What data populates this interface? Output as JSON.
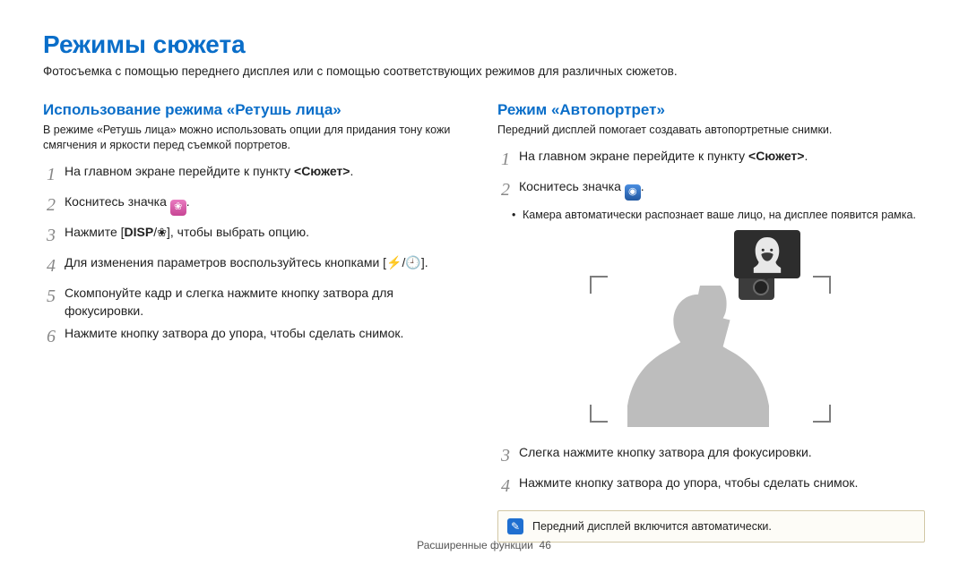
{
  "title": "Режимы сюжета",
  "intro": "Фотосъемка с помощью переднего дисплея или с помощью соответствующих режимов для различных сюжетов.",
  "left": {
    "heading": "Использование режима «Ретушь лица»",
    "desc": "В режиме «Ретушь лица» можно использовать опции для придания тону кожи смягчения и яркости перед съемкой портретов.",
    "steps": {
      "s1a": "На главном экране перейдите к пункту ",
      "s1b": "<Сюжет>",
      "s1c": ".",
      "s2a": "Коснитесь значка ",
      "s2b": ".",
      "s3a": "Нажмите [",
      "s3disp": "DISP",
      "s3slash": "/",
      "s3b": "], чтобы выбрать опцию.",
      "s4a": "Для изменения параметров воспользуйтесь кнопками [",
      "s4b": "/",
      "s4c": "].",
      "s5": "Скомпонуйте кадр и слегка нажмите кнопку затвора для фокусировки.",
      "s6": "Нажмите кнопку затвора до упора, чтобы сделать снимок."
    }
  },
  "right": {
    "heading": "Режим «Автопортрет»",
    "desc": "Передний дисплей помогает создавать автопортретные снимки.",
    "steps": {
      "s1a": "На главном экране перейдите к пункту ",
      "s1b": "<Сюжет>",
      "s1c": ".",
      "s2a": "Коснитесь значка ",
      "s2b": ".",
      "sub": "Камера автоматически распознает ваше лицо, на дисплее появится рамка.",
      "s3": "Слегка нажмите кнопку затвора для фокусировки.",
      "s4": "Нажмите кнопку затвора до упора, чтобы сделать снимок."
    },
    "note": "Передний дисплей включится автоматически."
  },
  "footer": {
    "label": "Расширенные функции",
    "page": "46"
  },
  "nums": {
    "n1": "1",
    "n2": "2",
    "n3": "3",
    "n4": "4",
    "n5": "5",
    "n6": "6"
  }
}
